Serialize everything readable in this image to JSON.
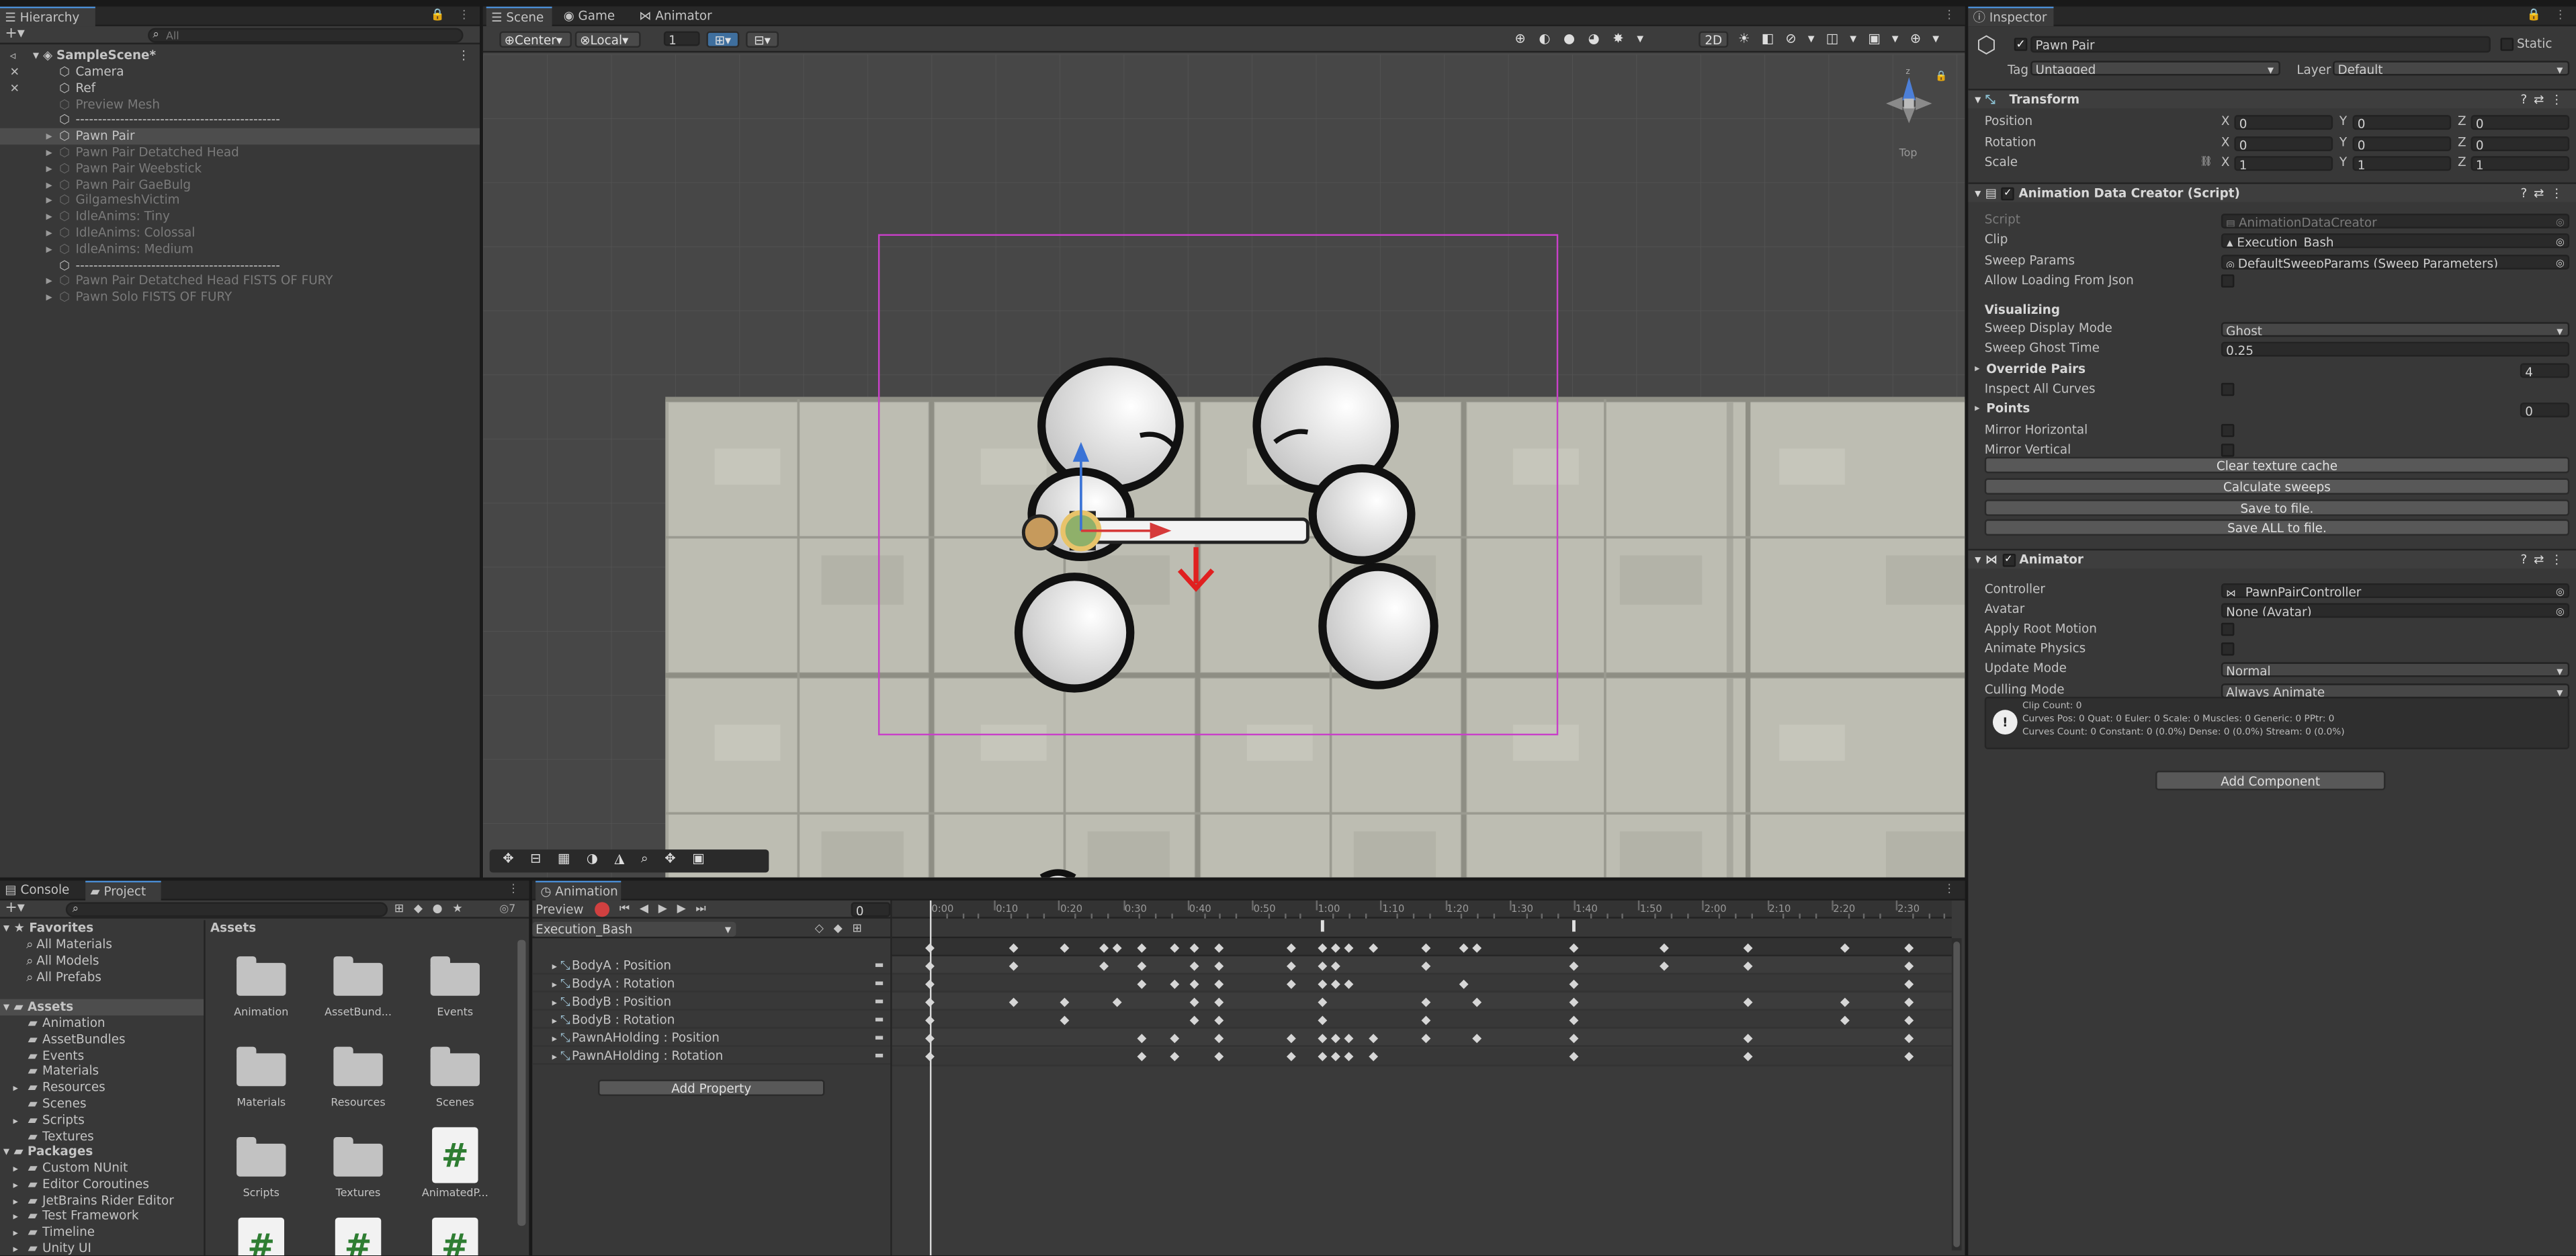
{
  "hierarchy": {
    "tab": "Hierarchy",
    "search_placeholder": "All",
    "scene": "SampleScene*",
    "items": [
      {
        "label": "Camera",
        "dim": false,
        "arrow": false
      },
      {
        "label": "Ref",
        "dim": false,
        "arrow": false
      },
      {
        "label": "Preview Mesh",
        "dim": true,
        "arrow": false
      },
      {
        "label": "----------------------------------------------",
        "dim": false,
        "arrow": false
      },
      {
        "label": "Pawn Pair",
        "dim": false,
        "arrow": true,
        "selected": true
      },
      {
        "label": "Pawn Pair Detatched Head",
        "dim": true,
        "arrow": true
      },
      {
        "label": "Pawn Pair Weebstick",
        "dim": true,
        "arrow": true
      },
      {
        "label": "Pawn Pair GaeBulg",
        "dim": true,
        "arrow": true
      },
      {
        "label": "GilgameshVictim",
        "dim": true,
        "arrow": true
      },
      {
        "label": "IdleAnims: Tiny",
        "dim": true,
        "arrow": true
      },
      {
        "label": "IdleAnims: Colossal",
        "dim": true,
        "arrow": true
      },
      {
        "label": "IdleAnims: Medium",
        "dim": true,
        "arrow": true
      },
      {
        "label": "----------------------------------------------",
        "dim": false,
        "arrow": false
      },
      {
        "label": "Pawn Pair Detatched Head FISTS OF FURY",
        "dim": true,
        "arrow": true
      },
      {
        "label": "Pawn Solo FISTS OF FURY",
        "dim": true,
        "arrow": true
      }
    ]
  },
  "scene_tabs": {
    "scene": "Scene",
    "game": "Game",
    "animator": "Animator"
  },
  "scene_toolbar": {
    "pivot": "Center",
    "space": "Local",
    "snap": "1",
    "mode2d": "2D"
  },
  "gizmo": {
    "label": "Top"
  },
  "inspector": {
    "tab": "Inspector",
    "object_name": "Pawn Pair",
    "static_label": "Static",
    "tag_label": "Tag",
    "tag_value": "Untagged",
    "layer_label": "Layer",
    "layer_value": "Default",
    "transform": {
      "title": "Transform",
      "rows": [
        {
          "label": "Position",
          "x": "0",
          "y": "0",
          "z": "0"
        },
        {
          "label": "Rotation",
          "x": "0",
          "y": "0",
          "z": "0"
        },
        {
          "label": "Scale",
          "x": "1",
          "y": "1",
          "z": "1"
        }
      ]
    },
    "adc": {
      "title": "Animation Data Creator (Script)",
      "script_label": "Script",
      "script_value": "AnimationDataCreator",
      "clip_label": "Clip",
      "clip_value": "Execution_Bash",
      "sweep_params_label": "Sweep Params",
      "sweep_params_value": "DefaultSweepParams (Sweep Parameters)",
      "allow_json_label": "Allow Loading From Json",
      "visualizing_label": "Visualizing",
      "sweep_mode_label": "Sweep Display Mode",
      "sweep_mode_value": "Ghost",
      "ghost_time_label": "Sweep Ghost Time",
      "ghost_time_value": "0.25",
      "override_pairs_label": "Override Pairs",
      "override_pairs_value": "4",
      "inspect_curves_label": "Inspect All Curves",
      "points_label": "Points",
      "points_value": "0",
      "mirror_h_label": "Mirror Horizontal",
      "mirror_v_label": "Mirror Vertical",
      "buttons": [
        "Clear texture cache",
        "Calculate sweeps",
        "Save to file.",
        "Save ALL to file."
      ]
    },
    "animator": {
      "title": "Animator",
      "controller_label": "Controller",
      "controller_value": "_PawnPairController",
      "avatar_label": "Avatar",
      "avatar_value": "None (Avatar)",
      "root_motion_label": "Apply Root Motion",
      "physics_label": "Animate Physics",
      "update_label": "Update Mode",
      "update_value": "Normal",
      "culling_label": "Culling Mode",
      "culling_value": "Always Animate",
      "info_lines": [
        "Clip Count: 0",
        "Curves Pos: 0 Quat: 0 Euler: 0 Scale: 0 Muscles: 0 Generic: 0 PPtr: 0",
        "Curves Count: 0 Constant: 0 (0.0%) Dense: 0 (0.0%) Stream: 0 (0.0%)"
      ]
    },
    "add_component": "Add Component"
  },
  "project": {
    "tabs": {
      "console": "Console",
      "project": "Project"
    },
    "hidden_count": "7",
    "favorites_label": "Favorites",
    "favorites": [
      "All Materials",
      "All Models",
      "All Prefabs"
    ],
    "assets_label": "Assets",
    "asset_folders": [
      "Animation",
      "AssetBundles",
      "Events",
      "Materials",
      "Resources",
      "Scenes",
      "Scripts",
      "Textures"
    ],
    "packages_label": "Packages",
    "packages": [
      "Custom NUnit",
      "Editor Coroutines",
      "JetBrains Rider Editor",
      "Test Framework",
      "Timeline",
      "Unity UI"
    ],
    "breadcrumb": "Assets",
    "grid": [
      {
        "label": "Animation",
        "kind": "folder"
      },
      {
        "label": "AssetBund...",
        "kind": "folder"
      },
      {
        "label": "Events",
        "kind": "folder"
      },
      {
        "label": "Materials",
        "kind": "folder"
      },
      {
        "label": "Resources",
        "kind": "folder"
      },
      {
        "label": "Scenes",
        "kind": "folder"
      },
      {
        "label": "Scripts",
        "kind": "folder"
      },
      {
        "label": "Textures",
        "kind": "folder"
      },
      {
        "label": "AnimatedP...",
        "kind": "script"
      },
      {
        "label": "",
        "kind": "script"
      },
      {
        "label": "",
        "kind": "script"
      },
      {
        "label": "",
        "kind": "script"
      }
    ]
  },
  "animation": {
    "tab": "Animation",
    "preview": "Preview",
    "frame": "0",
    "clip": "Execution_Bash",
    "properties": [
      "BodyA : Position",
      "BodyA : Rotation",
      "BodyB : Position",
      "BodyB : Rotation",
      "PawnAHolding : Position",
      "PawnAHolding : Rotation"
    ],
    "add_property": "Add Property",
    "time_labels": [
      "0:00",
      "0:10",
      "0:20",
      "0:30",
      "0:40",
      "0:50",
      "1:00",
      "1:10",
      "1:20",
      "1:30",
      "1:40",
      "1:50",
      "2:00",
      "2:10",
      "2:20",
      "2:30"
    ],
    "summary_keys": [
      0,
      13,
      21,
      27,
      29,
      33,
      38,
      41,
      45,
      56,
      61,
      63,
      65,
      69,
      77,
      83,
      85,
      100,
      114,
      127,
      142,
      152
    ],
    "tracks": [
      [
        0,
        13,
        27,
        33,
        41,
        45,
        56,
        61,
        63,
        77,
        100,
        114,
        127,
        152
      ],
      [
        0,
        33,
        38,
        41,
        45,
        56,
        61,
        63,
        65,
        83,
        100,
        152
      ],
      [
        0,
        13,
        21,
        29,
        41,
        45,
        61,
        77,
        85,
        100,
        127,
        142,
        152
      ],
      [
        0,
        21,
        41,
        45,
        61,
        77,
        100,
        142,
        152
      ],
      [
        0,
        33,
        38,
        45,
        56,
        61,
        63,
        65,
        69,
        77,
        85,
        100,
        127,
        152
      ],
      [
        0,
        33,
        38,
        45,
        56,
        61,
        63,
        65,
        69,
        100,
        127,
        152
      ]
    ],
    "event_markers": [
      61,
      100
    ]
  },
  "colors": {
    "accent": "#4a8ed6",
    "selection": "#4d4d4d",
    "record": "#d04040"
  }
}
